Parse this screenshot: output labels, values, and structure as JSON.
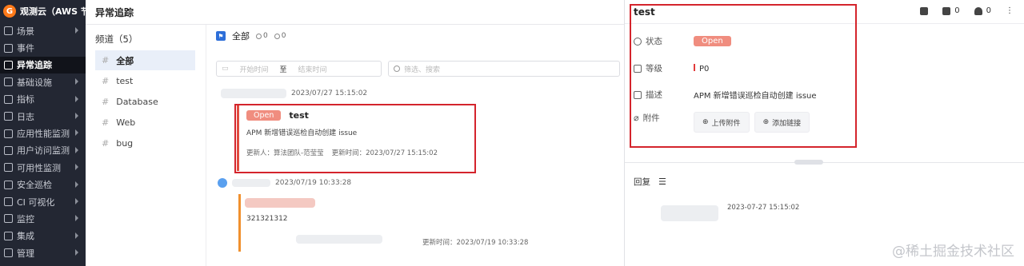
{
  "sidebar": {
    "brand": "观测云（AWS 节...",
    "items": [
      {
        "label": "场景",
        "arrow": true
      },
      {
        "label": "事件",
        "arrow": false
      },
      {
        "label": "异常追踪",
        "arrow": false,
        "active": true
      },
      {
        "label": "基础设施",
        "arrow": true
      },
      {
        "label": "指标",
        "arrow": true
      },
      {
        "label": "日志",
        "arrow": true
      },
      {
        "label": "应用性能监测",
        "arrow": true
      },
      {
        "label": "用户访问监测",
        "arrow": true
      },
      {
        "label": "可用性监测",
        "arrow": true
      },
      {
        "label": "安全巡检",
        "arrow": true
      },
      {
        "label": "CI 可视化",
        "arrow": true
      },
      {
        "label": "监控",
        "arrow": true
      },
      {
        "label": "集成",
        "arrow": true
      },
      {
        "label": "管理",
        "arrow": true
      }
    ]
  },
  "topbar": {
    "title": "异常追踪"
  },
  "channels": {
    "title": "频道（5）",
    "items": [
      "全部",
      "test",
      "Database",
      "Web",
      "bug"
    ]
  },
  "main": {
    "header": {
      "label": "全部",
      "count_a": "0",
      "count_b": "0"
    },
    "date_start_placeholder": "开始时间",
    "date_to": "至",
    "date_end_placeholder": "结束时间",
    "search_placeholder": "筛选、搜索",
    "issues": [
      {
        "time": "2023/07/27 15:15:02",
        "status": "Open",
        "title": "test",
        "desc": "APM 新增错误巡检自动创建 issue",
        "updater_label": "更新人：",
        "updater": "算法团队-范莹莹",
        "updated_label": "更新时间：",
        "updated": "2023/07/27 15:15:02"
      },
      {
        "time": "2023/07/19 10:33:28",
        "desc": "321321312",
        "updated_label": "更新时间：",
        "updated": "2023/07/19 10:33:28"
      }
    ]
  },
  "panel": {
    "title": "test",
    "tool_a": "0",
    "tool_b": "0",
    "status_label": "状态",
    "status": "Open",
    "level_label": "等级",
    "level": "P0",
    "desc_label": "描述",
    "desc": "APM 新增错误巡检自动创建 issue",
    "attach_label": "附件",
    "upload_btn": "上传附件",
    "link_btn": "添加链接",
    "reply_label": "回复",
    "reply_time": "2023-07-27 15:15:02",
    "watermark": "@稀土掘金技术社区"
  },
  "colors": {
    "status_open": "#f08d7f",
    "highlight": "#d4242c",
    "accent": "#2e6fd9",
    "sidebar": "#232733"
  }
}
